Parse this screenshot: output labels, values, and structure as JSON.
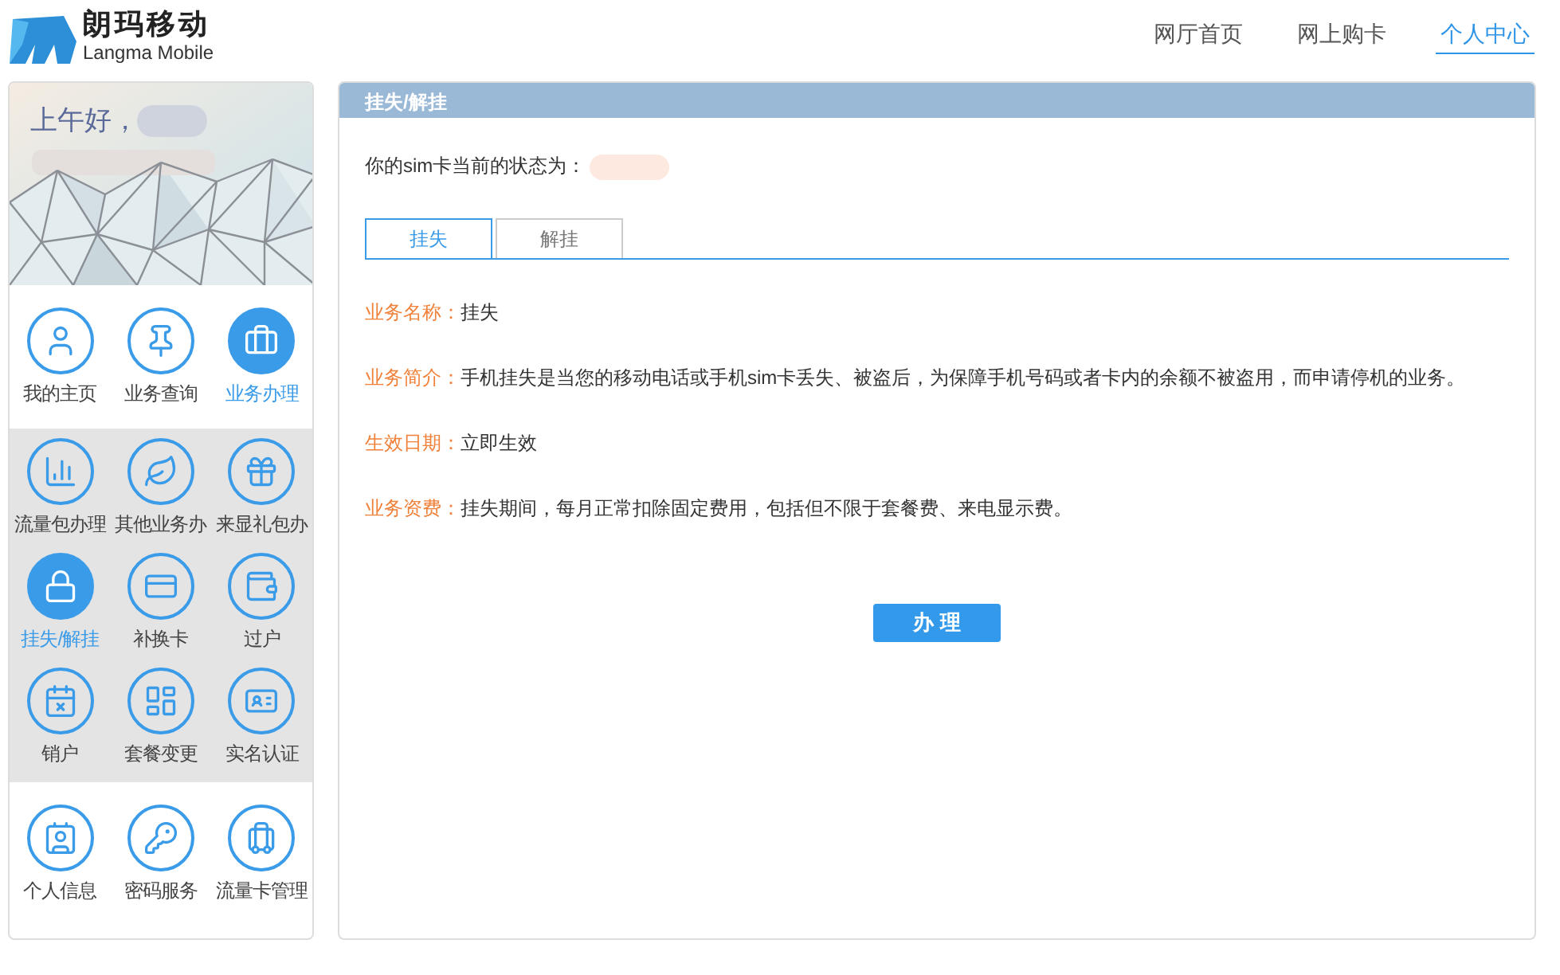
{
  "header": {
    "logo_title": "朗玛移动",
    "logo_subtitle": "Langma Mobile",
    "nav": [
      {
        "label": "网厅首页",
        "selected": false
      },
      {
        "label": "网上购卡",
        "selected": false
      },
      {
        "label": "个人中心",
        "selected": true
      }
    ]
  },
  "sidebar": {
    "greeting": "上午好，",
    "menu_groups": [
      {
        "expanded": false,
        "items": [
          {
            "label": "我的主页",
            "selected": false
          },
          {
            "label": "业务查询",
            "selected": false
          },
          {
            "label": "业务办理",
            "selected": true
          }
        ]
      },
      {
        "expanded": true,
        "items": [
          {
            "label": "流量包办理",
            "selected": false
          },
          {
            "label": "其他业务办",
            "selected": false
          },
          {
            "label": "来显礼包办",
            "selected": false
          },
          {
            "label": "挂失/解挂",
            "selected": true
          },
          {
            "label": "补换卡",
            "selected": false
          },
          {
            "label": "过户",
            "selected": false
          },
          {
            "label": "销户",
            "selected": false
          },
          {
            "label": "套餐变更",
            "selected": false
          },
          {
            "label": "实名认证",
            "selected": false
          }
        ]
      },
      {
        "expanded": false,
        "items": [
          {
            "label": "个人信息",
            "selected": false
          },
          {
            "label": "密码服务",
            "selected": false
          },
          {
            "label": "流量卡管理",
            "selected": false
          }
        ]
      }
    ]
  },
  "panel": {
    "title": "挂失/解挂",
    "status_label": "你的sim卡当前的状态为：",
    "tabs": [
      {
        "label": "挂失",
        "selected": true
      },
      {
        "label": "解挂",
        "selected": false
      }
    ],
    "details": [
      {
        "label": "业务名称：",
        "value": "挂失"
      },
      {
        "label": "业务简介：",
        "value": "手机挂失是当您的移动电话或手机sim卡丢失、被盗后，为保障手机号码或者卡内的余额不被盗用，而申请停机的业务。"
      },
      {
        "label": "生效日期：",
        "value": "立即生效"
      },
      {
        "label": "业务资费：",
        "value": "挂失期间，每月正常扣除固定费用，包括但不限于套餐费、来电显示费。"
      }
    ],
    "submit_button": "办 理"
  }
}
